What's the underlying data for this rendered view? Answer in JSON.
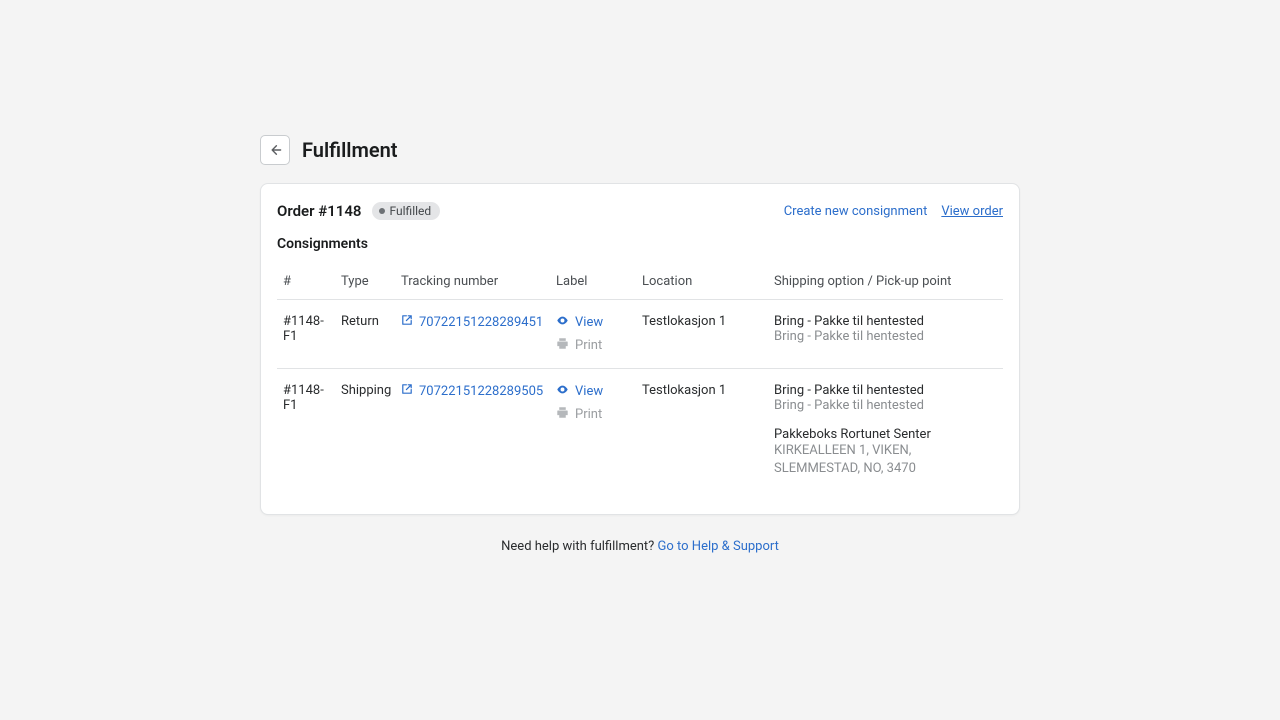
{
  "page_title": "Fulfillment",
  "order": {
    "title": "Order #1148",
    "badge": "Fulfilled"
  },
  "actions": {
    "create": "Create new consignment",
    "view_order": "View order"
  },
  "section_title": "Consignments",
  "columns": {
    "id": "#",
    "type": "Type",
    "tracking": "Tracking number",
    "label": "Label",
    "location": "Location",
    "shipping": "Shipping option / Pick-up point"
  },
  "label_actions": {
    "view": "View",
    "print": "Print"
  },
  "rows": [
    {
      "id": "#1148-F1",
      "type": "Return",
      "tracking": "70722151228289451",
      "location": "Testlokasjon 1",
      "shipping_option": "Bring - Pakke til hentested",
      "shipping_sub": "Bring - Pakke til hentested",
      "pickup_name": "",
      "pickup_address": ""
    },
    {
      "id": "#1148-F1",
      "type": "Shipping",
      "tracking": "70722151228289505",
      "location": "Testlokasjon 1",
      "shipping_option": "Bring - Pakke til hentested",
      "shipping_sub": "Bring - Pakke til hentested",
      "pickup_name": "Pakkeboks Rortunet Senter",
      "pickup_address": "KIRKEALLEEN 1, VIKEN, SLEMMESTAD, NO, 3470"
    }
  ],
  "footer": {
    "text": "Need help with fulfillment? ",
    "link": "Go to Help & Support"
  }
}
